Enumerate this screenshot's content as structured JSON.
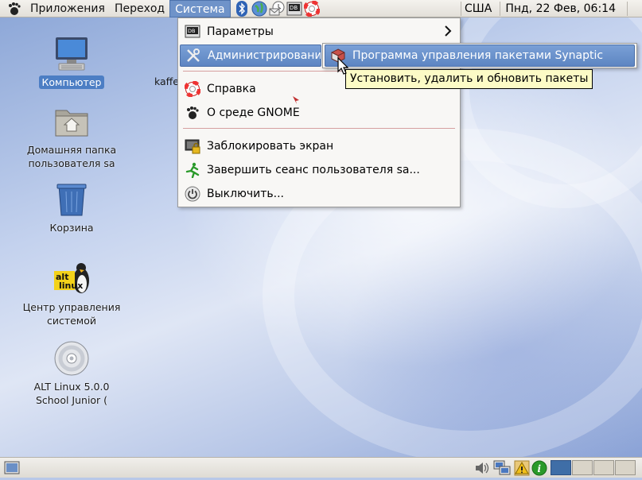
{
  "top_panel": {
    "menus": [
      "Приложения",
      "Переход",
      "Система"
    ],
    "active_menu": "Система",
    "launchers": [
      "bluetooth-icon",
      "globe-icon",
      "mail-icon",
      "tools-icon",
      "help-lifebuoy-icon"
    ],
    "keyboard_layout": "США",
    "clock": "Пнд, 22 Фев, 06:14"
  },
  "system_menu": {
    "items": [
      {
        "label": "Параметры",
        "icon": "preferences-icon",
        "has_submenu": true
      },
      {
        "label": "Администрировани",
        "icon": "administration-icon",
        "has_submenu": true,
        "highlighted": true
      },
      {
        "label": "Справка",
        "icon": "help-lifebuoy-icon"
      },
      {
        "label": "О среде GNOME",
        "icon": "gnome-foot-icon"
      },
      {
        "label": "Заблокировать экран",
        "icon": "lock-screen-icon"
      },
      {
        "label": "Завершить сеанс пользователя sa...",
        "icon": "logout-runner-icon"
      },
      {
        "label": "Выключить...",
        "icon": "power-icon"
      }
    ]
  },
  "submenu": {
    "item": {
      "label": "Программа управления пакетами Synaptic",
      "icon": "synaptic-package-icon"
    }
  },
  "tooltip": "Установить, удалить и обновить пакеты",
  "desktop": {
    "icons": [
      {
        "label": "Компьютер",
        "selected": true
      },
      {
        "label": "Домашняя папка пользователя sa"
      },
      {
        "label": "Корзина"
      },
      {
        "label": "Центр управления системой"
      },
      {
        "label": "ALT Linux 5.0.0 School Junior  ("
      }
    ],
    "partial_label": "kaffe"
  },
  "bottom_panel": {
    "tray": [
      "volume-icon",
      "network-icon",
      "warning-icon",
      "info-icon"
    ],
    "workspaces": 4,
    "active_workspace": 1
  }
}
